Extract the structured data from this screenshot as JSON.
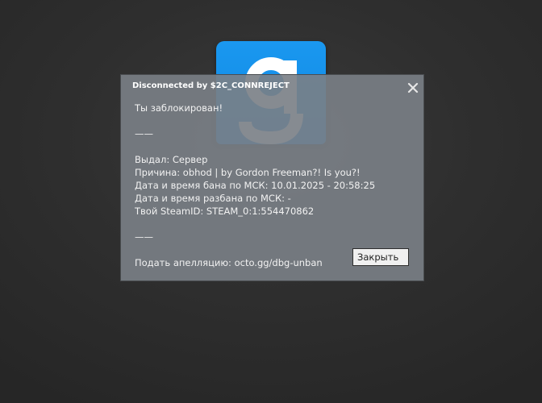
{
  "background": {
    "logo_letter": "g",
    "logo_color": "#1591ea"
  },
  "dialog": {
    "title": "Disconnected by $2C_CONNREJECT",
    "close_icon": "close-icon",
    "lines": {
      "header": "Ты заблокирован!",
      "sep1": "——",
      "issued_by": "Выдал: Сервер",
      "reason": "Причина: obhod | by Gordon Freeman?! Is you?!",
      "ban_date": "Дата и время бана по МСК: 10.01.2025 - 20:58:25",
      "unban_date": "Дата и время разбана по МСК: -",
      "steam_id": "Твой SteamID: STEAM_0:1:554470862",
      "sep2": "——",
      "appeal": "Подать апелляцию: octo.gg/dbg-unban"
    },
    "close_button_label": "Закрыть",
    "bg_color": "#7a8086"
  }
}
